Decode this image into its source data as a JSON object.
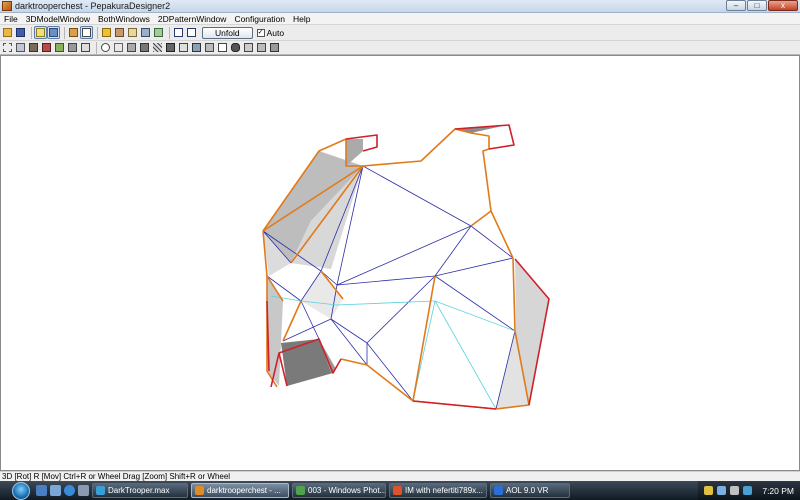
{
  "window": {
    "title": "darktrooperchest - PepakuraDesigner2",
    "minimize_label": "–",
    "maximize_label": "□",
    "close_label": "x"
  },
  "menu": [
    "File",
    "3DModelWindow",
    "BothWindows",
    "2DPatternWindow",
    "Configuration",
    "Help"
  ],
  "toolbar": {
    "unfold_label": "Unfold",
    "auto_checked": "✓",
    "auto_label": "Auto"
  },
  "status": {
    "text": "3D [Rot] R [Mov] Ctrl+R or Wheel Drag [Zoom] Shift+R or Wheel"
  },
  "taskbar": {
    "items": [
      {
        "label": "DarkTrooper.max",
        "icon_color": "#3a9fd6"
      },
      {
        "label": "darktrooperchest - ...",
        "icon_color": "#e08a2a"
      },
      {
        "label": "003 - Windows Phot...",
        "icon_color": "#4fa34a"
      },
      {
        "label": "IM with nefertiti789x...",
        "icon_color": "#e0532a"
      },
      {
        "label": "AOL 9.0 VR",
        "icon_color": "#2a6fd6"
      }
    ],
    "clock": "7:20 PM"
  },
  "colors": {
    "viewport_bg": "#ffffff",
    "edge_outline": "#e07a1a",
    "edge_inner": "#2b2fa8",
    "edge_fold": "#5ad1e0",
    "edge_cut": "#d0202a"
  }
}
